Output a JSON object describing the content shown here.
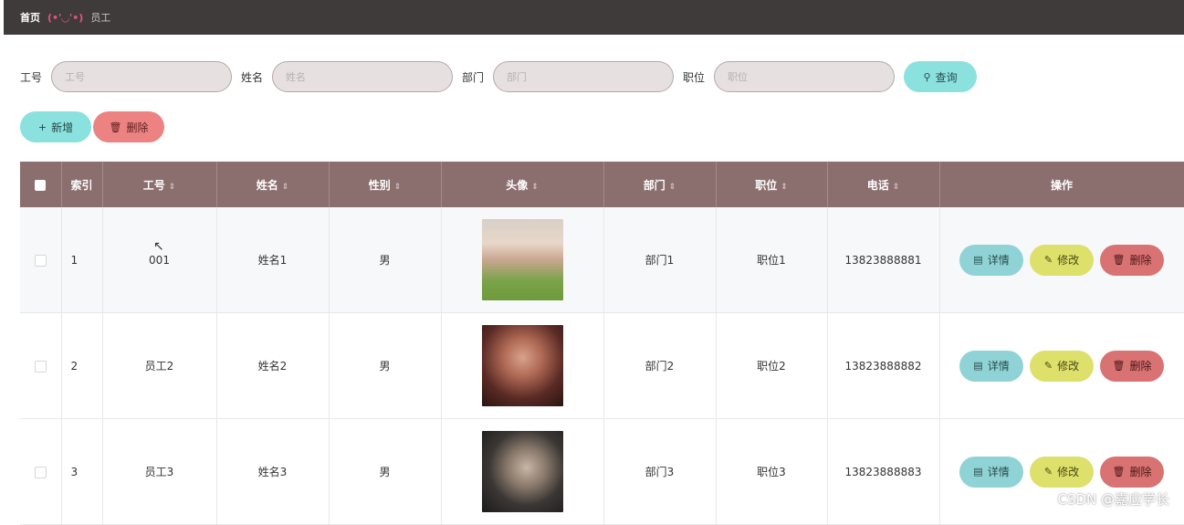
{
  "breadcrumb": {
    "home": "首页",
    "separator": "(•'◡'•)",
    "current": "员工"
  },
  "search": {
    "fields": [
      {
        "label": "工号",
        "placeholder": "工号",
        "value": ""
      },
      {
        "label": "姓名",
        "placeholder": "姓名",
        "value": ""
      },
      {
        "label": "部门",
        "placeholder": "部门",
        "value": ""
      },
      {
        "label": "职位",
        "placeholder": "职位",
        "value": ""
      }
    ],
    "query_label": "查询"
  },
  "actions": {
    "add_label": "新增",
    "delete_label": "删除"
  },
  "table": {
    "columns": [
      "索引",
      "工号",
      "姓名",
      "性别",
      "头像",
      "部门",
      "职位",
      "电话",
      "操作"
    ],
    "sort_icon": "⇕",
    "rows": [
      {
        "index": "1",
        "id": "001",
        "name": "姓名1",
        "gender": "男",
        "dept": "部门1",
        "position": "职位1",
        "phone": "13823888881"
      },
      {
        "index": "2",
        "id": "员工2",
        "name": "姓名2",
        "gender": "男",
        "dept": "部门2",
        "position": "职位2",
        "phone": "13823888882"
      },
      {
        "index": "3",
        "id": "员工3",
        "name": "姓名3",
        "gender": "男",
        "dept": "部门3",
        "position": "职位3",
        "phone": "13823888883"
      }
    ],
    "row_actions": {
      "detail": "详情",
      "edit": "修改",
      "delete": "删除"
    }
  },
  "watermark": "CSDN @嘉应学长",
  "colors": {
    "header_bg": "#3f3b3b",
    "table_head": "#8b6e6e",
    "teal": "#8be1de",
    "red": "#ec8282",
    "yellow": "#dde06a"
  }
}
